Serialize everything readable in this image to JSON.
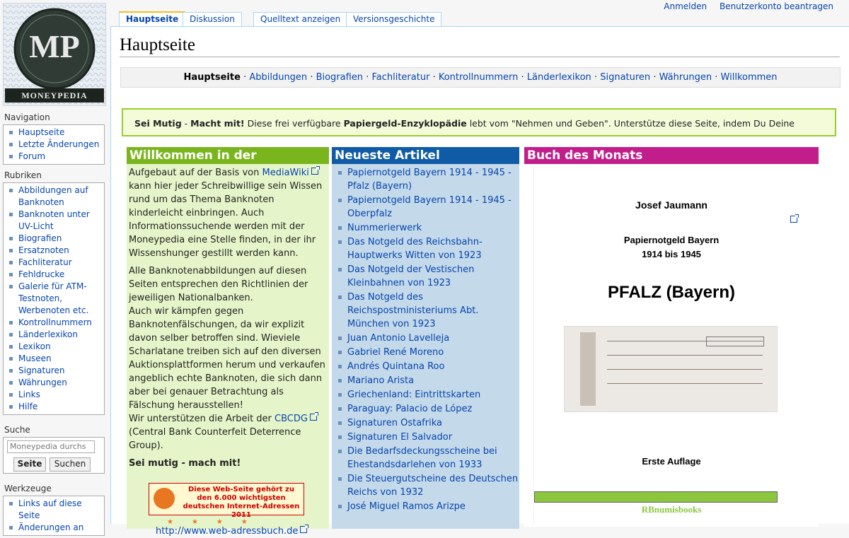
{
  "user_links": {
    "login": "Anmelden",
    "create_account": "Benutzerkonto beantragen"
  },
  "tabs": {
    "main": "Hauptseite",
    "discussion": "Diskussion",
    "view_source": "Quelltext anzeigen",
    "history": "Versionsgeschichte"
  },
  "logo": {
    "letters": "MP",
    "name": "MONEYPEDIA"
  },
  "page": {
    "title": "Hauptseite"
  },
  "navbar": {
    "current": "Hauptseite",
    "links": [
      "Abbildungen",
      "Biografien",
      "Fachliteratur",
      "Kontrollnummern",
      "Länderlexikon",
      "Signaturen",
      "Währungen",
      "Willkommen"
    ]
  },
  "mutig": {
    "bold1": "Sei Mutig",
    "sep": " - ",
    "bold2": "Macht mit!",
    "text1": " Diese frei verfügbare ",
    "bold3": "Papiergeld-Enzyklopädie",
    "text2": " lebt vom \"Nehmen und Geben\". Unterstütze diese Seite, indem Du Deine Erfahrungen weitergibst."
  },
  "welcome": {
    "heading": "Willkommen in der Moneypedia",
    "p1_a": "Aufgebaut auf der Basis von ",
    "p1_link": "MediaWiki",
    "p1_b": " kann hier jeder Schreibwillige sein Wissen rund um das Thema Banknoten kinderleicht einbringen. Auch Informationssuchende werden mit der Moneypedia eine Stelle finden, in der ihr Wissenshunger gestillt werden kann.",
    "p2": "Alle Banknotenabbildungen auf diesen Seiten entsprechen den Richtlinien der jeweiligen Nationalbanken.",
    "p3": "Auch wir kämpfen gegen Banknotenfälschungen, da wir explizit davon selber betroffen sind. Wieviele Scharlatane treiben sich auf den diversen Auktionsplattformen herum und verkaufen angeblich echte Banknoten, die sich dann aber bei genauer Betrachtung als Fälschung herausstellen!",
    "p4_a": "Wir unterstützen die Arbeit der ",
    "p4_link": "CBCDG",
    "p4_b": " (Central Bank Counterfeit Deterrence Group).",
    "bold": "Sei mutig - mach mit!",
    "ad_text": "Diese Web-Seite gehört zu den 6.000 wichtigsten deutschen Internet-Adressen 2011",
    "ad_link": "http://www.web-adressbuch.de"
  },
  "articles": {
    "heading": "Neueste Artikel",
    "items": [
      "Papiernotgeld Bayern 1914 - 1945 - Pfalz (Bayern)",
      "Papiernotgeld Bayern 1914 - 1945 - Oberpfalz",
      "Nummerierwerk",
      "Das Notgeld des Reichsbahn-Hauptwerks Witten von 1923",
      "Das Notgeld der Vestischen Kleinbahnen von 1923",
      "Das Notgeld des Reichspostministeriums Abt. München von 1923",
      "Juan Antonio Lavelleja",
      "Gabriel René Moreno",
      "Andrés Quintana Roo",
      "Mariano Arista",
      "Griechenland: Eintrittskarten",
      "Paraguay: Palacio de López",
      "Signaturen Ostafrika",
      "Signaturen El Salvador",
      "Die Bedarfsdeckungsscheine bei Ehestandsdarlehen von 1933",
      "Die Steuergutscheine des Deutschen Reichs von 1932",
      "José Miguel Ramos Arizpe"
    ]
  },
  "book": {
    "heading": "Buch des Monats",
    "author": "Josef Jaumann",
    "subtitle1": "Papiernotgeld Bayern",
    "subtitle2": "1914 bis 1945",
    "title": "PFALZ (Bayern)",
    "edition": "Erste Auflage",
    "publisher": "RBnumisbooks"
  },
  "sidebar": {
    "navigation": {
      "heading": "Navigation",
      "items": [
        "Hauptseite",
        "Letzte Änderungen",
        "Forum"
      ]
    },
    "rubriken": {
      "heading": "Rubriken",
      "items": [
        "Abbildungen auf Banknoten",
        "Banknoten unter UV-Licht",
        "Biografien",
        "Ersatznoten",
        "Fachliteratur",
        "Fehldrucke",
        "Galerie für ATM-Testnoten, Werbenoten etc.",
        "Kontrollnummern",
        "Länderlexikon",
        "Lexikon",
        "Museen",
        "Signaturen",
        "Währungen",
        "Links",
        "Hilfe"
      ]
    },
    "search": {
      "heading": "Suche",
      "placeholder": "Moneypedia durchs",
      "go": "Seite",
      "search": "Suchen"
    },
    "tools": {
      "heading": "Werkzeuge",
      "items": [
        "Links auf diese Seite",
        "Änderungen an"
      ]
    }
  }
}
